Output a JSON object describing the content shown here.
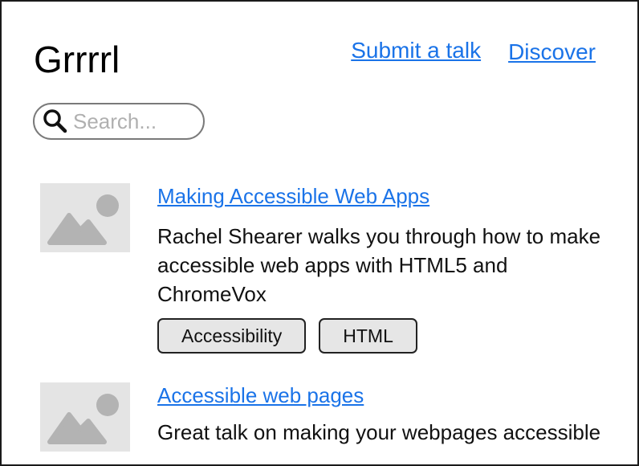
{
  "app": {
    "title": "Grrrrl"
  },
  "nav": {
    "items": [
      {
        "label": "Submit a talk"
      },
      {
        "label": "Discover"
      }
    ]
  },
  "search": {
    "placeholder": "Search...",
    "value": "",
    "icon": "search-icon"
  },
  "talks": [
    {
      "title": "Making Accessible Web Apps",
      "description": "Rachel Shearer walks you through how to make accessible web apps with HTML5 and ChromeVox",
      "thumbnail_icon": "image-placeholder-icon",
      "tags": [
        {
          "label": "Accessibility"
        },
        {
          "label": "HTML"
        }
      ]
    },
    {
      "title": "Accessible web pages",
      "description": "Great talk on making your webpages accessible",
      "thumbnail_icon": "image-placeholder-icon",
      "tags": []
    }
  ],
  "colors": {
    "link": "#1a73e8",
    "thumbnail_bg": "#e4e4e4",
    "thumbnail_glyph": "#b3b3b3",
    "tag_bg": "#e6e6e6",
    "border": "#1a1a1a"
  }
}
